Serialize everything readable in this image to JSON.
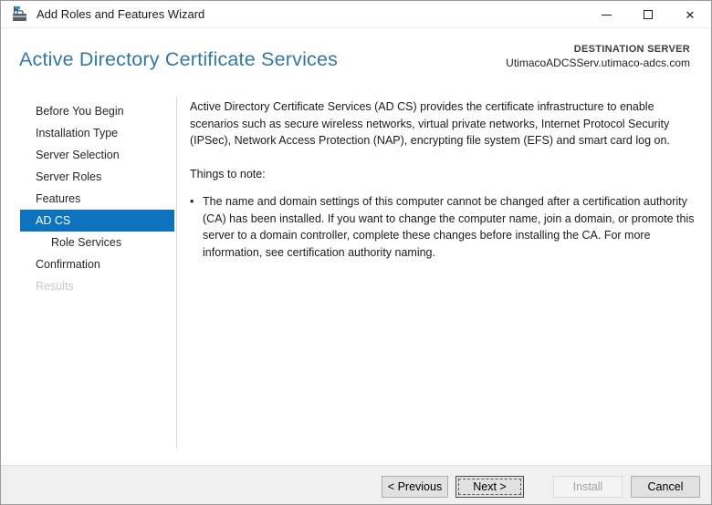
{
  "window": {
    "title": "Add Roles and Features Wizard",
    "controls": {
      "close_glyph": "✕"
    }
  },
  "header": {
    "title": "Active Directory Certificate Services",
    "destination_label": "DESTINATION SERVER",
    "destination_server": "UtimacoADCSServ.utimaco-adcs.com"
  },
  "sidebar": {
    "items": [
      {
        "label": "Before You Begin",
        "state": "normal"
      },
      {
        "label": "Installation Type",
        "state": "normal"
      },
      {
        "label": "Server Selection",
        "state": "normal"
      },
      {
        "label": "Server Roles",
        "state": "normal"
      },
      {
        "label": "Features",
        "state": "normal"
      },
      {
        "label": "AD CS",
        "state": "selected"
      },
      {
        "label": "Role Services",
        "state": "child"
      },
      {
        "label": "Confirmation",
        "state": "normal"
      },
      {
        "label": "Results",
        "state": "disabled"
      }
    ]
  },
  "content": {
    "intro": "Active Directory Certificate Services (AD CS) provides the certificate infrastructure to enable scenarios such as secure wireless networks, virtual private networks, Internet Protocol Security (IPSec), Network Access Protection (NAP), encrypting file system (EFS) and smart card log on.",
    "note_heading": "Things to note:",
    "bullet": "The name and domain settings of this computer cannot be changed after a certification authority (CA) has been installed. If you want to change the computer name, join a domain, or promote this server to a domain controller, complete these changes before installing the CA. For more information, see certification authority naming."
  },
  "footer": {
    "previous_label": "< Previous",
    "next_label": "Next >",
    "install_label": "Install",
    "cancel_label": "Cancel"
  },
  "colors": {
    "accent_title": "#3179a8",
    "nav_selected": "#0d73bf",
    "footer_bg": "#f0f0f0",
    "button_bg": "#e1e1e1",
    "button_border": "#adadad"
  }
}
